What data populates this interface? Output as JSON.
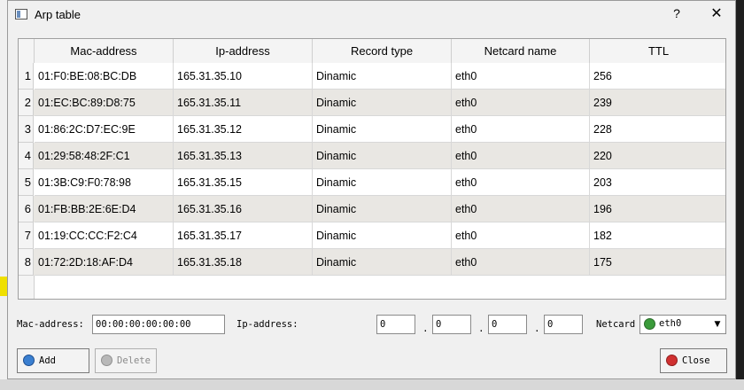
{
  "window": {
    "title": "Arp table",
    "help_label": "?",
    "close_label": "✕"
  },
  "table": {
    "columns": [
      "Mac-address",
      "Ip-address",
      "Record type",
      "Netcard name",
      "TTL"
    ],
    "rows": [
      {
        "n": "1",
        "mac": "01:F0:BE:08:BC:DB",
        "ip": "165.31.35.10",
        "type": "Dinamic",
        "netcard": "eth0",
        "ttl": "256"
      },
      {
        "n": "2",
        "mac": "01:EC:BC:89:D8:75",
        "ip": "165.31.35.11",
        "type": "Dinamic",
        "netcard": "eth0",
        "ttl": "239"
      },
      {
        "n": "3",
        "mac": "01:86:2C:D7:EC:9E",
        "ip": "165.31.35.12",
        "type": "Dinamic",
        "netcard": "eth0",
        "ttl": "228"
      },
      {
        "n": "4",
        "mac": "01:29:58:48:2F:C1",
        "ip": "165.31.35.13",
        "type": "Dinamic",
        "netcard": "eth0",
        "ttl": "220"
      },
      {
        "n": "5",
        "mac": "01:3B:C9:F0:78:98",
        "ip": "165.31.35.15",
        "type": "Dinamic",
        "netcard": "eth0",
        "ttl": "203"
      },
      {
        "n": "6",
        "mac": "01:FB:BB:2E:6E:D4",
        "ip": "165.31.35.16",
        "type": "Dinamic",
        "netcard": "eth0",
        "ttl": "196"
      },
      {
        "n": "7",
        "mac": "01:19:CC:CC:F2:C4",
        "ip": "165.31.35.17",
        "type": "Dinamic",
        "netcard": "eth0",
        "ttl": "182"
      },
      {
        "n": "8",
        "mac": "01:72:2D:18:AF:D4",
        "ip": "165.31.35.18",
        "type": "Dinamic",
        "netcard": "eth0",
        "ttl": "175"
      }
    ]
  },
  "form": {
    "mac_label": "Mac-address:",
    "mac_value": "00:00:00:00:00:00",
    "ip_label": "Ip-address:",
    "ip_octets": [
      "0",
      "0",
      "0",
      "0"
    ],
    "ip_sep": ".",
    "netcard_label": "Netcard",
    "netcard_value": "eth0",
    "netcard_icon": "green-globe-icon"
  },
  "buttons": {
    "add": "Add",
    "delete": "Delete",
    "close": "Close"
  },
  "colors": {
    "alt_row": "#e9e7e3",
    "add_icon": "#3a7fd0",
    "close_icon": "#d03030"
  }
}
